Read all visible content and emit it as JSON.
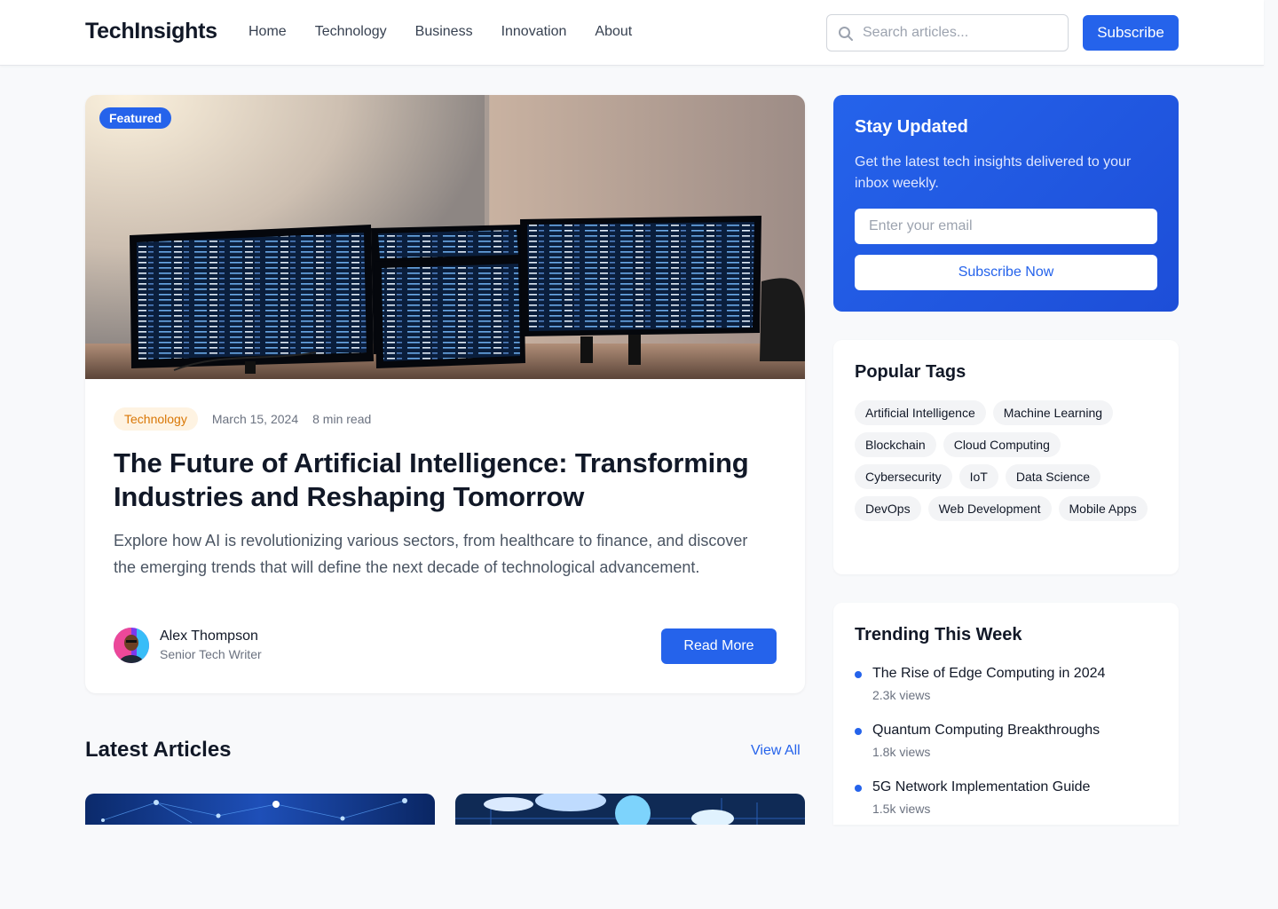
{
  "header": {
    "logo": "TechInsights",
    "nav": [
      "Home",
      "Technology",
      "Business",
      "Innovation",
      "About"
    ],
    "search_placeholder": "Search articles...",
    "subscribe_label": "Subscribe"
  },
  "featured": {
    "badge": "Featured",
    "category": "Technology",
    "date": "March 15, 2024",
    "read_time": "8 min read",
    "title": "The Future of Artificial Intelligence: Transforming Industries and Reshaping Tomorrow",
    "excerpt": "Explore how AI is revolutionizing various sectors, from healthcare to finance, and discover the emerging trends that will define the next decade of technological advancement.",
    "author_name": "Alex Thompson",
    "author_role": "Senior Tech Writer",
    "read_more": "Read More"
  },
  "latest": {
    "title": "Latest Articles",
    "view_all": "View All"
  },
  "newsletter": {
    "title": "Stay Updated",
    "description": "Get the latest tech insights delivered to your inbox weekly.",
    "email_placeholder": "Enter your email",
    "button": "Subscribe Now"
  },
  "tags": {
    "title": "Popular Tags",
    "items": [
      "Artificial Intelligence",
      "Machine Learning",
      "Blockchain",
      "Cloud Computing",
      "Cybersecurity",
      "IoT",
      "Data Science",
      "DevOps",
      "Web Development",
      "Mobile Apps"
    ]
  },
  "trending": {
    "title": "Trending This Week",
    "items": [
      {
        "title": "The Rise of Edge Computing in 2024",
        "views": "2.3k views"
      },
      {
        "title": "Quantum Computing Breakthroughs",
        "views": "1.8k views"
      },
      {
        "title": "5G Network Implementation Guide",
        "views": "1.5k views"
      }
    ]
  },
  "colors": {
    "accent": "#2563eb",
    "category_bg": "#fef3e2",
    "category_text": "#d97706"
  }
}
